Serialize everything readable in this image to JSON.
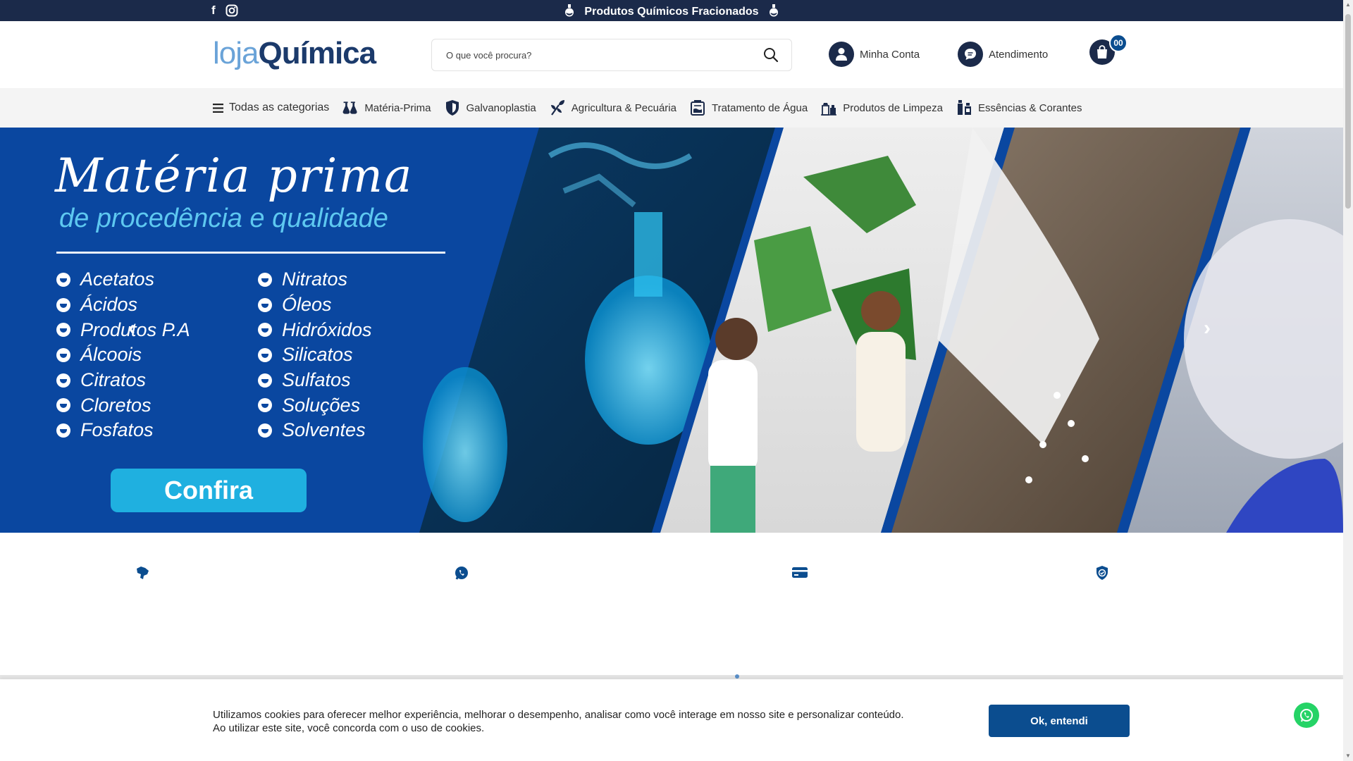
{
  "topbar": {
    "promo": "Produtos Químicos Fracionados",
    "social": [
      {
        "icon": "facebook-icon",
        "glyph": "f"
      },
      {
        "icon": "instagram-icon",
        "glyph": "◎"
      }
    ]
  },
  "header": {
    "logo_part1": "loja",
    "logo_part2": "Química",
    "search_placeholder": "O que você procura?",
    "account_label": "Minha Conta",
    "support_label": "Atendimento",
    "cart_count": "00"
  },
  "nav": {
    "all_categories": "Todas as categorias",
    "items": [
      {
        "label": "Matéria-Prima",
        "icon": "flasks-icon"
      },
      {
        "label": "Galvanoplastia",
        "icon": "shield-icon"
      },
      {
        "label": "Agricultura & Pecuária",
        "icon": "plant-icon"
      },
      {
        "label": "Tratamento de Água",
        "icon": "water-tank-icon"
      },
      {
        "label": "Produtos de Limpeza",
        "icon": "cleaning-icon"
      },
      {
        "label": "Essências & Corantes",
        "icon": "bottles-icon"
      }
    ]
  },
  "hero": {
    "title": "Matéria prima",
    "subtitle": "de procedência e qualidade",
    "col1": [
      "Acetatos",
      "Ácidos",
      "Produtos P.A",
      "Álcoois",
      "Citratos",
      "Cloretos",
      "Fosfatos"
    ],
    "col2": [
      "Nitratos",
      "Óleos",
      "Hidróxidos",
      "Silicatos",
      "Sulfatos",
      "Soluções",
      "Solventes"
    ],
    "cta": "Confira"
  },
  "features": [
    {
      "icon": "brazil-map-icon"
    },
    {
      "icon": "whatsapp-icon"
    },
    {
      "icon": "credit-card-icon"
    },
    {
      "icon": "security-shield-icon"
    }
  ],
  "cookie": {
    "text_line1": "Utilizamos cookies para oferecer melhor experiência, melhorar o desempenho, analisar como você interage em nosso site e personalizar conteúdo.",
    "text_line2": "Ao utilizar este site, você concorda com o uso de cookies.",
    "button": "Ok, entendi"
  },
  "colors": {
    "navy": "#1b2a4a",
    "brand_blue": "#0b4d8f",
    "hero_blue": "#0a47a0",
    "cta_cyan": "#1fb0e0"
  }
}
